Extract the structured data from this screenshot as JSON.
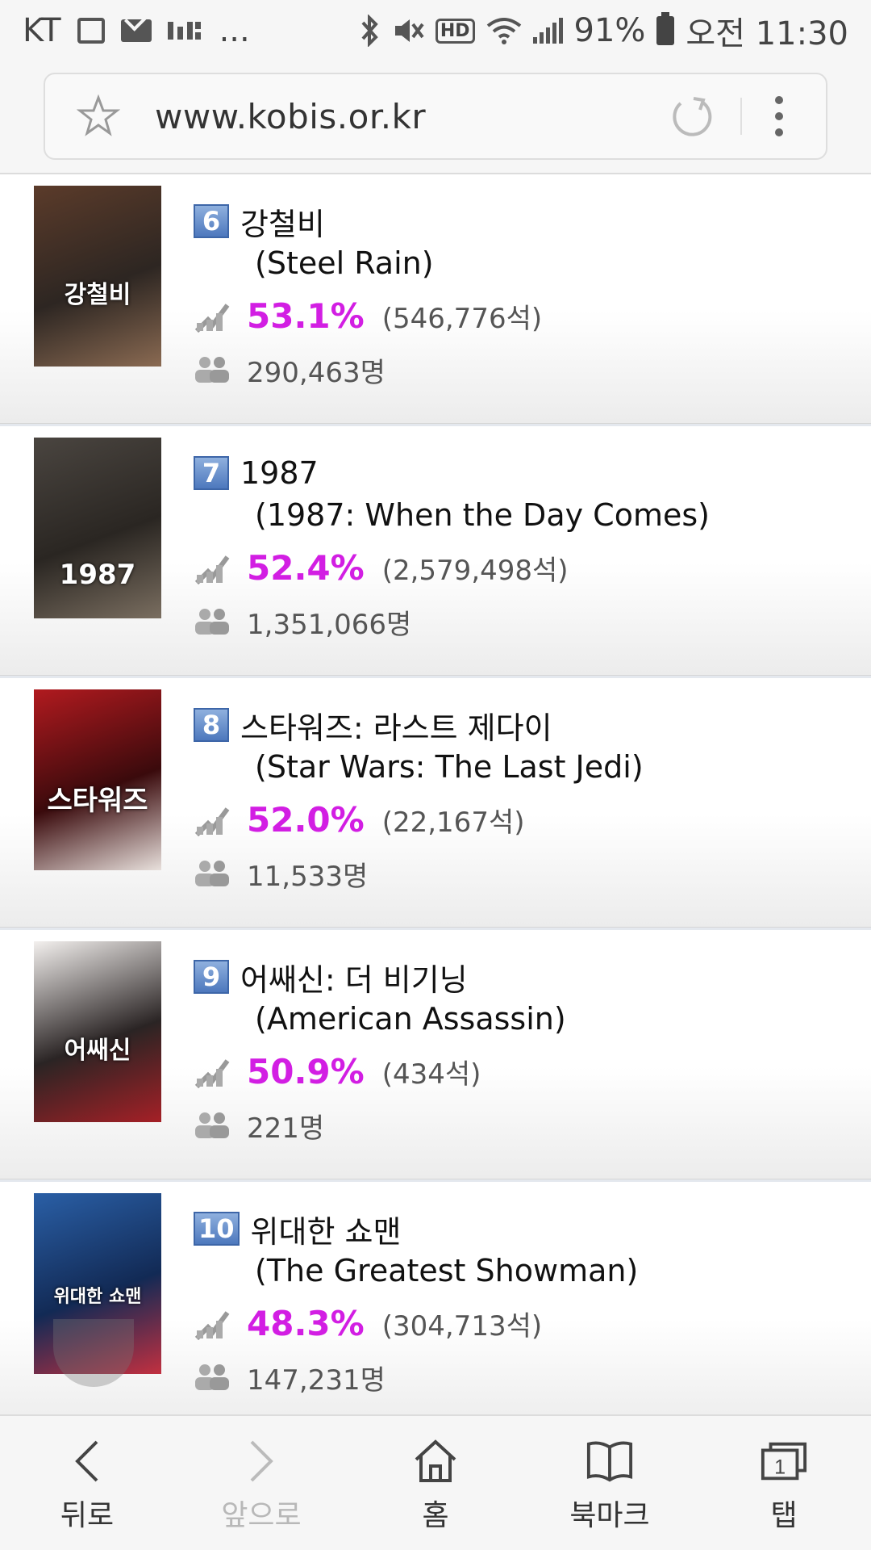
{
  "status_bar": {
    "carrier": "KT",
    "more": "...",
    "hd_label": "HD",
    "battery": "91%",
    "time": "오전 11:30"
  },
  "browser": {
    "url": "www.kobis.or.kr"
  },
  "movies": [
    {
      "rank": "6",
      "title_ko": "강철비",
      "title_en": "(Steel Rain)",
      "rate": "53.1%",
      "seats": "(546,776석)",
      "audience": "290,463명",
      "poster_text": "강철비",
      "poster_colors": [
        "#5b3b2a",
        "#2d2622",
        "#8a6a52"
      ]
    },
    {
      "rank": "7",
      "title_ko": "1987",
      "title_en": "(1987: When the Day Comes)",
      "rate": "52.4%",
      "seats": "(2,579,498석)",
      "audience": "1,351,066명",
      "poster_text": "1987",
      "poster_colors": [
        "#4a4540",
        "#2a2622",
        "#7a6e60"
      ]
    },
    {
      "rank": "8",
      "title_ko": "스타워즈: 라스트 제다이",
      "title_en": "(Star Wars: The Last Jedi)",
      "rate": "52.0%",
      "seats": "(22,167석)",
      "audience": "11,533명",
      "poster_text": "스타워즈",
      "poster_colors": [
        "#b11a1f",
        "#3a0a0c",
        "#e8e0dc"
      ]
    },
    {
      "rank": "9",
      "title_ko": "어쌔신: 더 비기닝",
      "title_en": "(American Assassin)",
      "rate": "50.9%",
      "seats": "(434석)",
      "audience": "221명",
      "poster_text": "어쌔신",
      "poster_colors": [
        "#f3f0ee",
        "#2a2424",
        "#a52026"
      ]
    },
    {
      "rank": "10",
      "title_ko": "위대한 쇼맨",
      "title_en": "(The Greatest Showman)",
      "rate": "48.3%",
      "seats": "(304,713석)",
      "audience": "147,231명",
      "poster_text": "위대한 쇼맨",
      "poster_colors": [
        "#2a5fa6",
        "#122a55",
        "#c23040"
      ]
    }
  ],
  "bottom_nav": {
    "back": "뒤로",
    "forward": "앞으로",
    "home": "홈",
    "bookmarks": "북마크",
    "tabs": "탭",
    "tab_count": "1"
  },
  "colors": {
    "rate": "#d21ee3",
    "badge": "#4d78bd"
  }
}
